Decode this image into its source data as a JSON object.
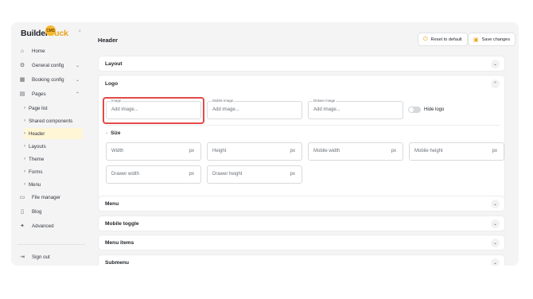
{
  "brand": {
    "name_part1": "Builder",
    "name_part2": "Duck",
    "badge": "CMS"
  },
  "sidebar": {
    "items": [
      {
        "label": "Home",
        "icon": "home-icon"
      },
      {
        "label": "General config",
        "icon": "gear-icon"
      },
      {
        "label": "Booking config",
        "icon": "calendar-icon"
      },
      {
        "label": "Pages",
        "icon": "table-icon"
      }
    ],
    "pages_sub": [
      "Page list",
      "Shared components",
      "Header",
      "Layouts",
      "Theme",
      "Forms",
      "Menu"
    ],
    "items2": [
      {
        "label": "File manager",
        "icon": "folder-icon"
      },
      {
        "label": "Blog",
        "icon": "document-icon"
      },
      {
        "label": "Advanced",
        "icon": "advanced-icon"
      }
    ],
    "signout": "Sign out"
  },
  "header": {
    "title": "Header",
    "reset_label": "Reset to default",
    "save_label": "Save changes"
  },
  "sections": {
    "layout": "Layout",
    "logo": "Logo",
    "menu": "Menu",
    "mobile_toggle": "Mobile toggle",
    "menu_items": "Menu items",
    "submenu": "Submenu"
  },
  "logo_section": {
    "image": {
      "label": "Image",
      "placeholder": "Add image..."
    },
    "mobile_image": {
      "label": "Mobile image",
      "placeholder": "Add image..."
    },
    "drawer_image": {
      "label": "Drawer image",
      "placeholder": "Add image..."
    },
    "hide_logo": "Hide logo",
    "size_title": "Size",
    "unit": "px",
    "fields": {
      "width": "Width",
      "height": "Height",
      "mobile_width": "Mobile width",
      "mobile_height": "Mobile height",
      "drawer_width": "Drawer width",
      "drawer_height": "Drawer height"
    }
  },
  "colors": {
    "accent": "#e8a317",
    "highlight": "#e24a4a",
    "active_bg": "#fff6d6"
  }
}
